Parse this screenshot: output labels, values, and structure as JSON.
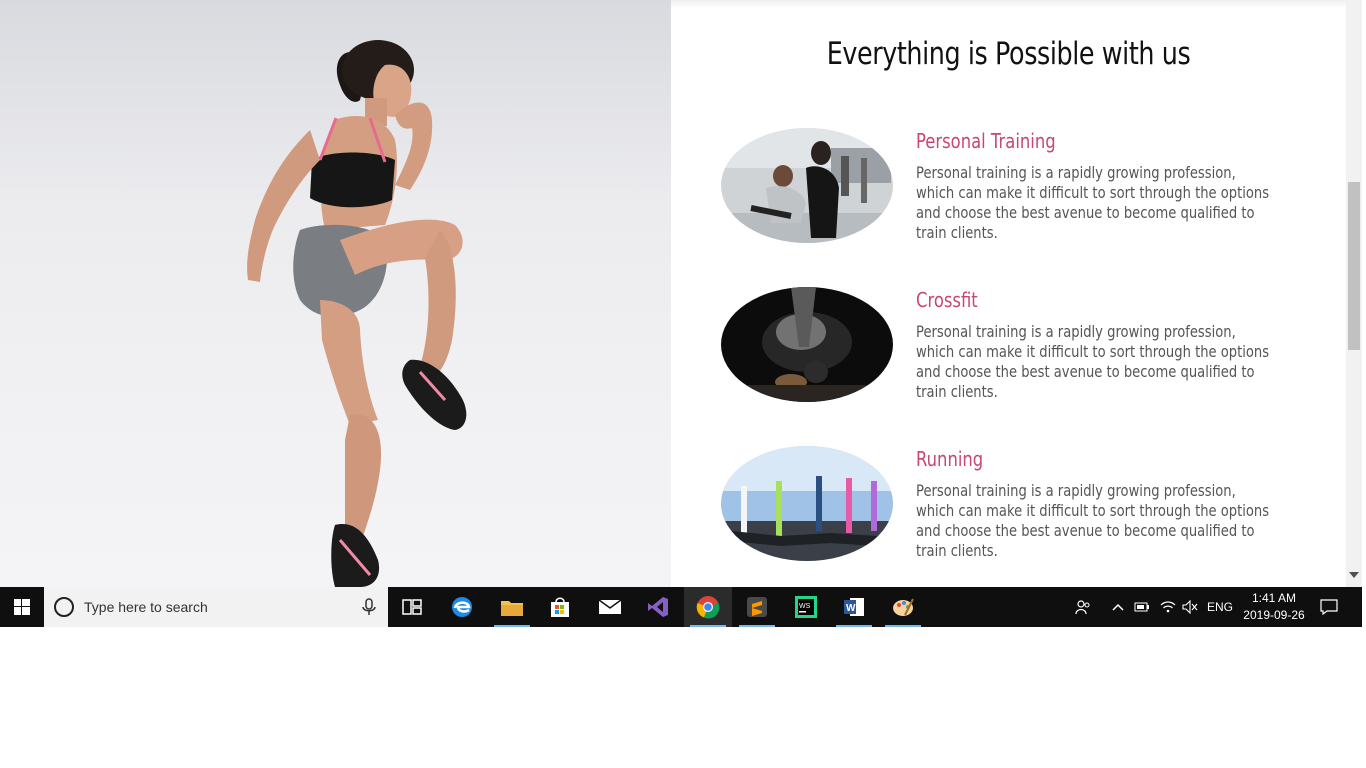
{
  "page": {
    "section_title": "Everything is Possible with us",
    "services": [
      {
        "title": "Personal Training",
        "desc_lines": [
          "Personal training is a rapidly growing profession,",
          "which can make it difficult to sort through the options",
          "and choose the best avenue to become qualified to",
          "train clients."
        ],
        "image": "personal-training-photo"
      },
      {
        "title": "Crossfit",
        "desc_lines": [
          "Personal training is a rapidly growing profession,",
          "which can make it difficult to sort through the options",
          "and choose the best avenue to become qualified to",
          "train clients."
        ],
        "image": "crossfit-photo"
      },
      {
        "title": "Running",
        "desc_lines": [
          "Personal training is a rapidly growing profession,",
          "which can make it difficult to sort through the options",
          "and choose the best avenue to become qualified to",
          "train clients."
        ],
        "image": "running-photo"
      }
    ],
    "hero_image": "athlete-photo",
    "accent_color": "#c8466f"
  },
  "taskbar": {
    "search_placeholder": "Type here to search",
    "apps": [
      "task-view-icon",
      "edge-icon",
      "file-explorer-icon",
      "store-icon",
      "mail-icon",
      "visual-studio-icon",
      "chrome-icon",
      "sublime-text-icon",
      "webstorm-icon",
      "word-icon",
      "paint-icon"
    ],
    "language": "ENG",
    "time": "1:41 AM",
    "date": "2019-09-26"
  }
}
